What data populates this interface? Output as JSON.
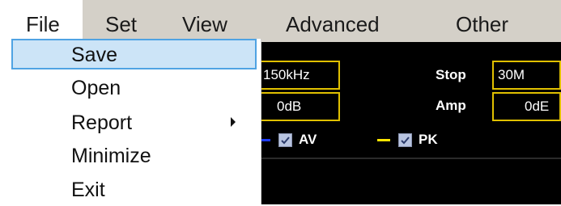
{
  "menubar": {
    "items": [
      {
        "label": "File"
      },
      {
        "label": "Set"
      },
      {
        "label": "View"
      },
      {
        "label": "Advanced"
      },
      {
        "label": "Other"
      }
    ]
  },
  "file_menu": {
    "items": [
      {
        "label": "Save",
        "selected": true
      },
      {
        "label": "Open"
      },
      {
        "label": "Report",
        "has_submenu": true
      },
      {
        "label": "Minimize"
      },
      {
        "label": "Exit"
      }
    ]
  },
  "settings": {
    "start_value": "150kHz",
    "stop_label": "Stop",
    "stop_value": "30M",
    "ref_value": "0dB",
    "amp_label": "Amp",
    "amp_value": "0dE"
  },
  "legend": [
    {
      "label": "AV",
      "color": "#1e3cff",
      "checked": true
    },
    {
      "label": "PK",
      "color": "#ffe600",
      "checked": true
    }
  ],
  "colors": {
    "menubar_bg": "#d4d0c8",
    "panel_bg": "#000000",
    "field_border": "#e0c000",
    "selection_bg": "#cce4f7",
    "selection_border": "#4fa3e3"
  }
}
